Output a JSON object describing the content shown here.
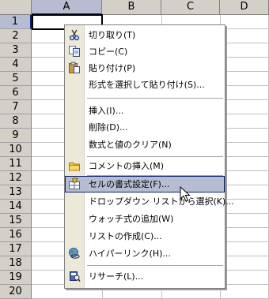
{
  "columns": [
    "A",
    "B",
    "C",
    "D"
  ],
  "rows": [
    "1",
    "2",
    "3",
    "4",
    "5",
    "6",
    "7",
    "8",
    "9",
    "10",
    "11",
    "12",
    "13",
    "14",
    "15",
    "16",
    "17",
    "18",
    "19",
    "20"
  ],
  "menu": {
    "items": [
      {
        "id": "cut",
        "label": "切り取り(T)",
        "icon": "scissors-icon"
      },
      {
        "id": "copy",
        "label": "コピー(C)",
        "icon": "copy-icon"
      },
      {
        "id": "paste",
        "label": "貼り付け(P)",
        "icon": "paste-icon"
      },
      {
        "id": "paste-special",
        "label": "形式を選択して貼り付け(S)...",
        "icon": ""
      },
      {
        "id": "insert",
        "label": "挿入(I)...",
        "icon": ""
      },
      {
        "id": "delete",
        "label": "削除(D)...",
        "icon": ""
      },
      {
        "id": "clear-contents",
        "label": "数式と値のクリア(N)",
        "icon": ""
      },
      {
        "id": "insert-comment",
        "label": "コメントの挿入(M)",
        "icon": "comment-folder-icon"
      },
      {
        "id": "format-cells",
        "label": "セルの書式設定(F)...",
        "icon": "format-cells-icon"
      },
      {
        "id": "pick-from-list",
        "label": "ドロップダウン リストから選択(K)...",
        "icon": ""
      },
      {
        "id": "add-watch",
        "label": "ウォッチ式の追加(W)",
        "icon": ""
      },
      {
        "id": "create-list",
        "label": "リストの作成(C)...",
        "icon": ""
      },
      {
        "id": "hyperlink",
        "label": "ハイパーリンク(H)...",
        "icon": "hyperlink-globe-icon"
      },
      {
        "id": "research",
        "label": "リサーチ(L)...",
        "icon": "research-book-icon"
      }
    ],
    "hovered": "format-cells"
  },
  "colors": {
    "header_bg": "#d4d0c8",
    "header_selected": "#b6bdd2",
    "menu_highlight": "#b6bdd2",
    "menu_gutter": "#ece9d8"
  }
}
